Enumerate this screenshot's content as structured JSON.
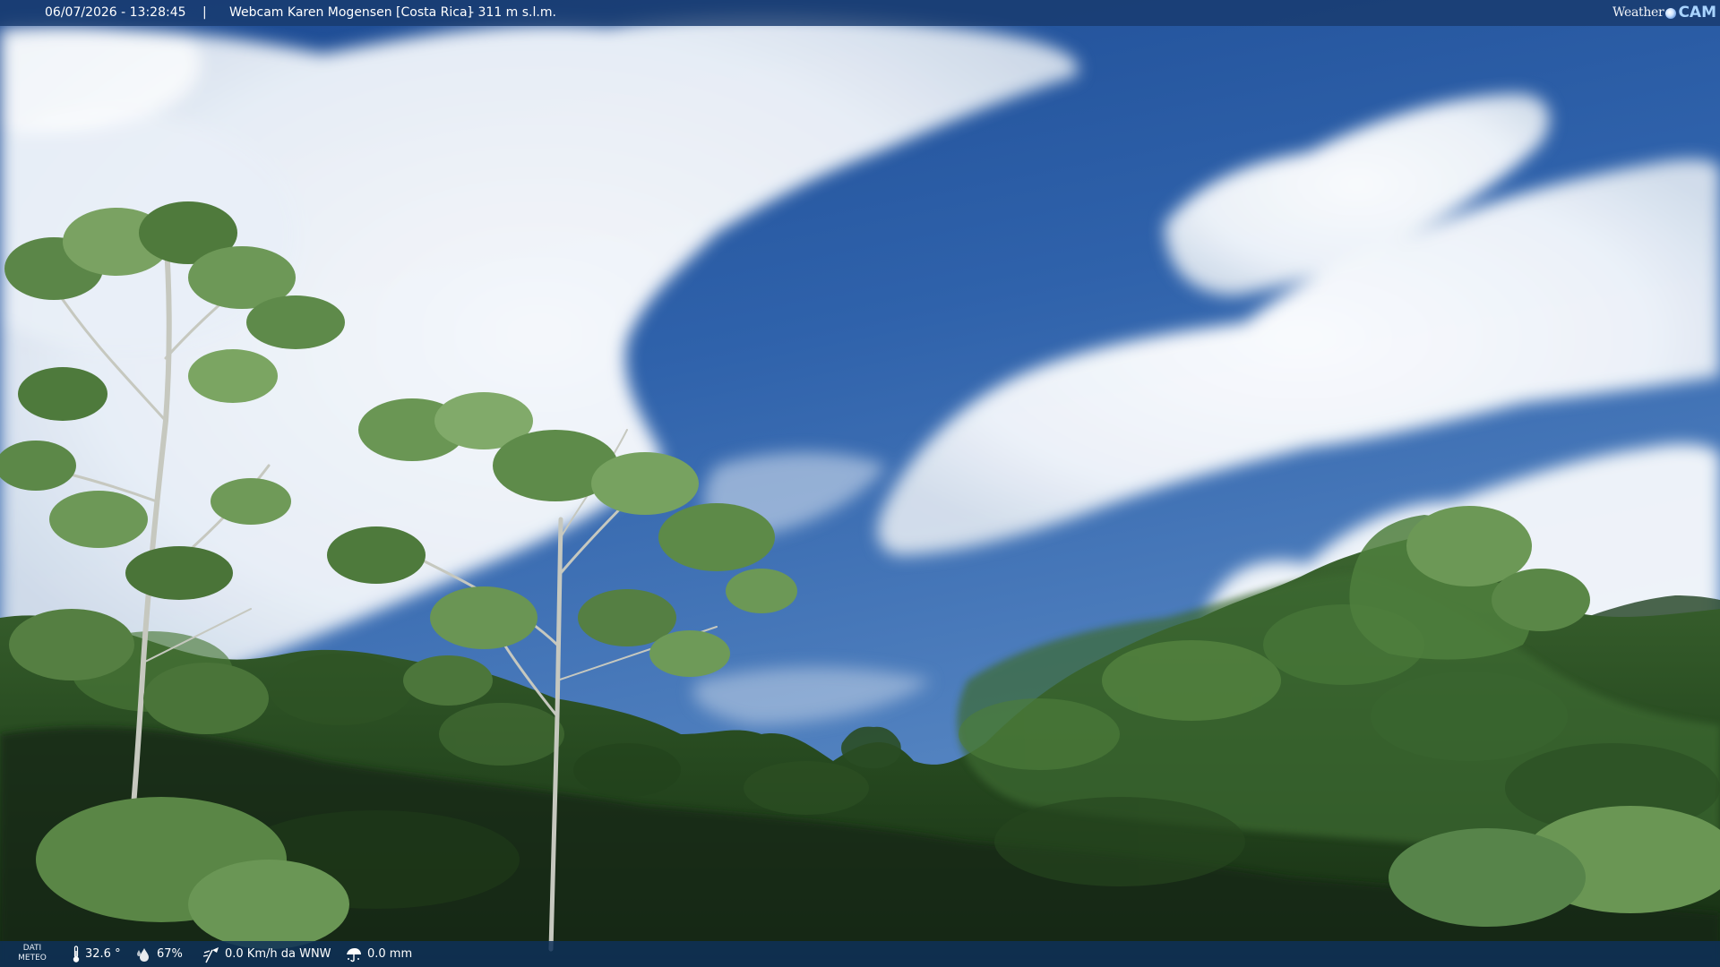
{
  "overlay_top": {
    "datetime": "06/07/2026 - 13:28:45",
    "separator": "|",
    "camera_title": "Webcam Karen Mogensen [Costa Rica]",
    "altitude": "- 311 m s.l.m.",
    "brand": {
      "part1": "Weather",
      "part2": "CAM"
    }
  },
  "overlay_bottom": {
    "meteo_label_line1": "DATI",
    "meteo_label_line2": "METEO",
    "temperature": "32.6 °",
    "humidity": "67%",
    "wind": "0.0 Km/h da WNW",
    "rain": "0.0 mm"
  },
  "icons": {
    "temperature": "thermometer-icon",
    "humidity": "humidity-drop-icon",
    "wind": "wind-icon",
    "rain": "rain-gauge-icon"
  },
  "colors": {
    "sky_top": "#1f4f97",
    "sky_mid": "#3a6db2",
    "cloud": "#ffffff",
    "forest_dark": "#1a3316",
    "forest_mid": "#355a28",
    "leaf_light": "#6c9454",
    "bar_top": "#183a6e",
    "bar_bottom": "#0e3058",
    "brand_cam": "#a9d4ff"
  }
}
